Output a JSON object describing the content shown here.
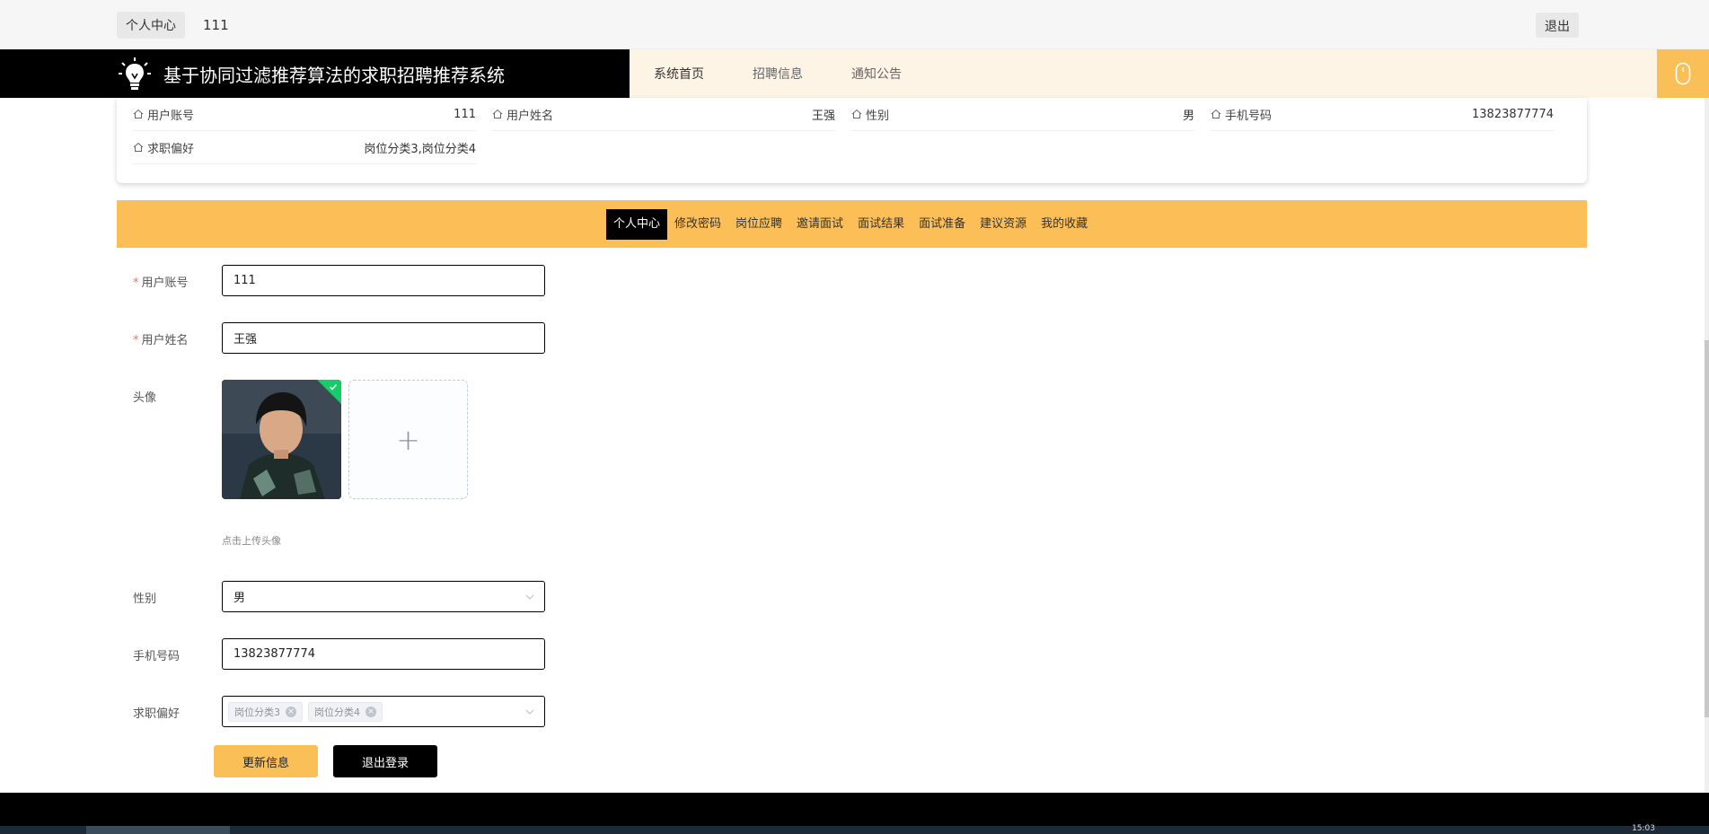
{
  "topbar": {
    "tag": "个人中心",
    "username": "111",
    "logout": "退出"
  },
  "header": {
    "title": "基于协同过滤推荐算法的求职招聘推荐系统",
    "nav": [
      "系统首页",
      "招聘信息",
      "通知公告"
    ],
    "icon": "mouse-icon"
  },
  "info": {
    "account_label": "用户账号",
    "account_value": "111",
    "name_label": "用户姓名",
    "name_value": "王强",
    "gender_label": "性别",
    "gender_value": "男",
    "phone_label": "手机号码",
    "phone_value": "13823877774",
    "pref_label": "求职偏好",
    "pref_value": "岗位分类3,岗位分类4"
  },
  "tabs": [
    "个人中心",
    "修改密码",
    "岗位应聘",
    "邀请面试",
    "面试结果",
    "面试准备",
    "建议资源",
    "我的收藏"
  ],
  "form": {
    "required_mark": "*",
    "account_label": "用户账号",
    "account_value": "111",
    "name_label": "用户姓名",
    "name_value": "王强",
    "avatar_label": "头像",
    "upload_tip": "点击上传头像",
    "upload_plus": "+",
    "gender_label": "性别",
    "gender_value": "男",
    "phone_label": "手机号码",
    "phone_value": "13823877774",
    "pref_label": "求职偏好",
    "pref_tags": [
      "岗位分类3",
      "岗位分类4"
    ]
  },
  "buttons": {
    "update": "更新信息",
    "logout": "退出登录"
  },
  "taskbar": {
    "clock": "15:03"
  },
  "colors": {
    "accent": "#fcbe57",
    "header_bg": "#fdf4e6",
    "brand_bg": "#000000",
    "required": "#f56c6c"
  }
}
